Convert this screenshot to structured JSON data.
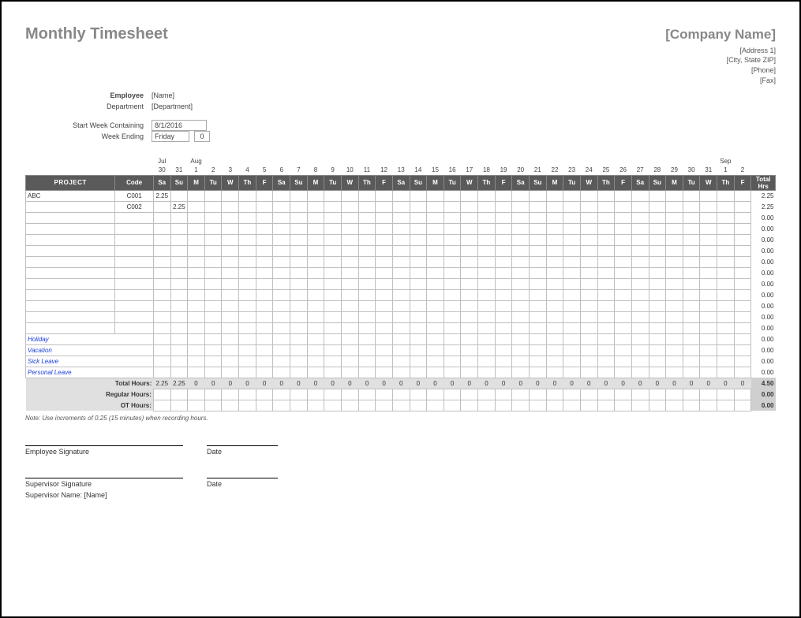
{
  "title": "Monthly Timesheet",
  "company": {
    "name": "[Company Name]",
    "address1": "[Address 1]",
    "address2": "[City, State ZIP]",
    "phone": "[Phone]",
    "fax": "[Fax]"
  },
  "info": {
    "employee_label": "Employee",
    "employee_value": "[Name]",
    "department_label": "Department",
    "department_value": "[Department]",
    "start_week_label": "Start Week Containing",
    "start_week_value": "8/1/2016",
    "week_ending_label": "Week Ending",
    "week_ending_day": "Friday",
    "week_ending_offset": "0"
  },
  "months": {
    "m1": "Jul",
    "m2": "Aug",
    "m3": "Sep"
  },
  "day_numbers": [
    "30",
    "31",
    "1",
    "2",
    "3",
    "4",
    "5",
    "6",
    "7",
    "8",
    "9",
    "10",
    "11",
    "12",
    "13",
    "14",
    "15",
    "16",
    "17",
    "18",
    "19",
    "20",
    "21",
    "22",
    "23",
    "24",
    "25",
    "26",
    "27",
    "28",
    "29",
    "30",
    "31",
    "1",
    "2"
  ],
  "day_names": [
    "Sa",
    "Su",
    "M",
    "Tu",
    "W",
    "Th",
    "F",
    "Sa",
    "Su",
    "M",
    "Tu",
    "W",
    "Th",
    "F",
    "Sa",
    "Su",
    "M",
    "Tu",
    "W",
    "Th",
    "F",
    "Sa",
    "Su",
    "M",
    "Tu",
    "W",
    "Th",
    "F",
    "Sa",
    "Su",
    "M",
    "Tu",
    "W",
    "Th",
    "F"
  ],
  "headers": {
    "project": "PROJECT",
    "code": "Code",
    "total_hrs": "Total Hrs"
  },
  "rows": [
    {
      "project": "ABC",
      "code": "C001",
      "cells": [
        "2.25",
        "",
        "",
        "",
        "",
        "",
        "",
        "",
        "",
        "",
        "",
        "",
        "",
        "",
        "",
        "",
        "",
        "",
        "",
        "",
        "",
        "",
        "",
        "",
        "",
        "",
        "",
        "",
        "",
        "",
        "",
        "",
        "",
        "",
        ""
      ],
      "total": "2.25"
    },
    {
      "project": "",
      "code": "C002",
      "cells": [
        "",
        "2.25",
        "",
        "",
        "",
        "",
        "",
        "",
        "",
        "",
        "",
        "",
        "",
        "",
        "",
        "",
        "",
        "",
        "",
        "",
        "",
        "",
        "",
        "",
        "",
        "",
        "",
        "",
        "",
        "",
        "",
        "",
        "",
        "",
        ""
      ],
      "total": "2.25"
    },
    {
      "project": "",
      "code": "",
      "cells": [
        "",
        "",
        "",
        "",
        "",
        "",
        "",
        "",
        "",
        "",
        "",
        "",
        "",
        "",
        "",
        "",
        "",
        "",
        "",
        "",
        "",
        "",
        "",
        "",
        "",
        "",
        "",
        "",
        "",
        "",
        "",
        "",
        "",
        "",
        ""
      ],
      "total": "0.00"
    },
    {
      "project": "",
      "code": "",
      "cells": [
        "",
        "",
        "",
        "",
        "",
        "",
        "",
        "",
        "",
        "",
        "",
        "",
        "",
        "",
        "",
        "",
        "",
        "",
        "",
        "",
        "",
        "",
        "",
        "",
        "",
        "",
        "",
        "",
        "",
        "",
        "",
        "",
        "",
        "",
        ""
      ],
      "total": "0.00"
    },
    {
      "project": "",
      "code": "",
      "cells": [
        "",
        "",
        "",
        "",
        "",
        "",
        "",
        "",
        "",
        "",
        "",
        "",
        "",
        "",
        "",
        "",
        "",
        "",
        "",
        "",
        "",
        "",
        "",
        "",
        "",
        "",
        "",
        "",
        "",
        "",
        "",
        "",
        "",
        "",
        ""
      ],
      "total": "0.00"
    },
    {
      "project": "",
      "code": "",
      "cells": [
        "",
        "",
        "",
        "",
        "",
        "",
        "",
        "",
        "",
        "",
        "",
        "",
        "",
        "",
        "",
        "",
        "",
        "",
        "",
        "",
        "",
        "",
        "",
        "",
        "",
        "",
        "",
        "",
        "",
        "",
        "",
        "",
        "",
        "",
        ""
      ],
      "total": "0.00"
    },
    {
      "project": "",
      "code": "",
      "cells": [
        "",
        "",
        "",
        "",
        "",
        "",
        "",
        "",
        "",
        "",
        "",
        "",
        "",
        "",
        "",
        "",
        "",
        "",
        "",
        "",
        "",
        "",
        "",
        "",
        "",
        "",
        "",
        "",
        "",
        "",
        "",
        "",
        "",
        "",
        ""
      ],
      "total": "0.00"
    },
    {
      "project": "",
      "code": "",
      "cells": [
        "",
        "",
        "",
        "",
        "",
        "",
        "",
        "",
        "",
        "",
        "",
        "",
        "",
        "",
        "",
        "",
        "",
        "",
        "",
        "",
        "",
        "",
        "",
        "",
        "",
        "",
        "",
        "",
        "",
        "",
        "",
        "",
        "",
        "",
        ""
      ],
      "total": "0.00"
    },
    {
      "project": "",
      "code": "",
      "cells": [
        "",
        "",
        "",
        "",
        "",
        "",
        "",
        "",
        "",
        "",
        "",
        "",
        "",
        "",
        "",
        "",
        "",
        "",
        "",
        "",
        "",
        "",
        "",
        "",
        "",
        "",
        "",
        "",
        "",
        "",
        "",
        "",
        "",
        "",
        ""
      ],
      "total": "0.00"
    },
    {
      "project": "",
      "code": "",
      "cells": [
        "",
        "",
        "",
        "",
        "",
        "",
        "",
        "",
        "",
        "",
        "",
        "",
        "",
        "",
        "",
        "",
        "",
        "",
        "",
        "",
        "",
        "",
        "",
        "",
        "",
        "",
        "",
        "",
        "",
        "",
        "",
        "",
        "",
        "",
        ""
      ],
      "total": "0.00"
    },
    {
      "project": "",
      "code": "",
      "cells": [
        "",
        "",
        "",
        "",
        "",
        "",
        "",
        "",
        "",
        "",
        "",
        "",
        "",
        "",
        "",
        "",
        "",
        "",
        "",
        "",
        "",
        "",
        "",
        "",
        "",
        "",
        "",
        "",
        "",
        "",
        "",
        "",
        "",
        "",
        ""
      ],
      "total": "0.00"
    },
    {
      "project": "",
      "code": "",
      "cells": [
        "",
        "",
        "",
        "",
        "",
        "",
        "",
        "",
        "",
        "",
        "",
        "",
        "",
        "",
        "",
        "",
        "",
        "",
        "",
        "",
        "",
        "",
        "",
        "",
        "",
        "",
        "",
        "",
        "",
        "",
        "",
        "",
        "",
        "",
        ""
      ],
      "total": "0.00"
    },
    {
      "project": "",
      "code": "",
      "cells": [
        "",
        "",
        "",
        "",
        "",
        "",
        "",
        "",
        "",
        "",
        "",
        "",
        "",
        "",
        "",
        "",
        "",
        "",
        "",
        "",
        "",
        "",
        "",
        "",
        "",
        "",
        "",
        "",
        "",
        "",
        "",
        "",
        "",
        "",
        ""
      ],
      "total": "0.00"
    }
  ],
  "leave_rows": [
    {
      "label": "Holiday",
      "cells": [
        "",
        "",
        "",
        "",
        "",
        "",
        "",
        "",
        "",
        "",
        "",
        "",
        "",
        "",
        "",
        "",
        "",
        "",
        "",
        "",
        "",
        "",
        "",
        "",
        "",
        "",
        "",
        "",
        "",
        "",
        "",
        "",
        "",
        "",
        ""
      ],
      "total": "0.00"
    },
    {
      "label": "Vacation",
      "cells": [
        "",
        "",
        "",
        "",
        "",
        "",
        "",
        "",
        "",
        "",
        "",
        "",
        "",
        "",
        "",
        "",
        "",
        "",
        "",
        "",
        "",
        "",
        "",
        "",
        "",
        "",
        "",
        "",
        "",
        "",
        "",
        "",
        "",
        "",
        ""
      ],
      "total": "0.00"
    },
    {
      "label": "Sick Leave",
      "cells": [
        "",
        "",
        "",
        "",
        "",
        "",
        "",
        "",
        "",
        "",
        "",
        "",
        "",
        "",
        "",
        "",
        "",
        "",
        "",
        "",
        "",
        "",
        "",
        "",
        "",
        "",
        "",
        "",
        "",
        "",
        "",
        "",
        "",
        "",
        ""
      ],
      "total": "0.00"
    },
    {
      "label": "Personal Leave",
      "cells": [
        "",
        "",
        "",
        "",
        "",
        "",
        "",
        "",
        "",
        "",
        "",
        "",
        "",
        "",
        "",
        "",
        "",
        "",
        "",
        "",
        "",
        "",
        "",
        "",
        "",
        "",
        "",
        "",
        "",
        "",
        "",
        "",
        "",
        "",
        ""
      ],
      "total": "0.00"
    }
  ],
  "summary": {
    "total_label": "Total Hours:",
    "total_cells": [
      "2.25",
      "2.25",
      "0",
      "0",
      "0",
      "0",
      "0",
      "0",
      "0",
      "0",
      "0",
      "0",
      "0",
      "0",
      "0",
      "0",
      "0",
      "0",
      "0",
      "0",
      "0",
      "0",
      "0",
      "0",
      "0",
      "0",
      "0",
      "0",
      "0",
      "0",
      "0",
      "0",
      "0",
      "0",
      "0"
    ],
    "total_sum": "4.50",
    "regular_label": "Regular Hours:",
    "regular_cells": [
      "",
      "",
      "",
      "",
      "",
      "",
      "",
      "",
      "",
      "",
      "",
      "",
      "",
      "",
      "",
      "",
      "",
      "",
      "",
      "",
      "",
      "",
      "",
      "",
      "",
      "",
      "",
      "",
      "",
      "",
      "",
      "",
      "",
      "",
      ""
    ],
    "regular_sum": "0.00",
    "ot_label": "OT Hours:",
    "ot_cells": [
      "",
      "",
      "",
      "",
      "",
      "",
      "",
      "",
      "",
      "",
      "",
      "",
      "",
      "",
      "",
      "",
      "",
      "",
      "",
      "",
      "",
      "",
      "",
      "",
      "",
      "",
      "",
      "",
      "",
      "",
      "",
      "",
      "",
      "",
      ""
    ],
    "ot_sum": "0.00"
  },
  "note": "Note: Use increments of 0.25 (15 minutes) when recording hours.",
  "signatures": {
    "emp_sig": "Employee Signature",
    "date": "Date",
    "sup_sig": "Supervisor Signature",
    "sup_name_label": "Supervisor Name:",
    "sup_name_value": "[Name]"
  }
}
